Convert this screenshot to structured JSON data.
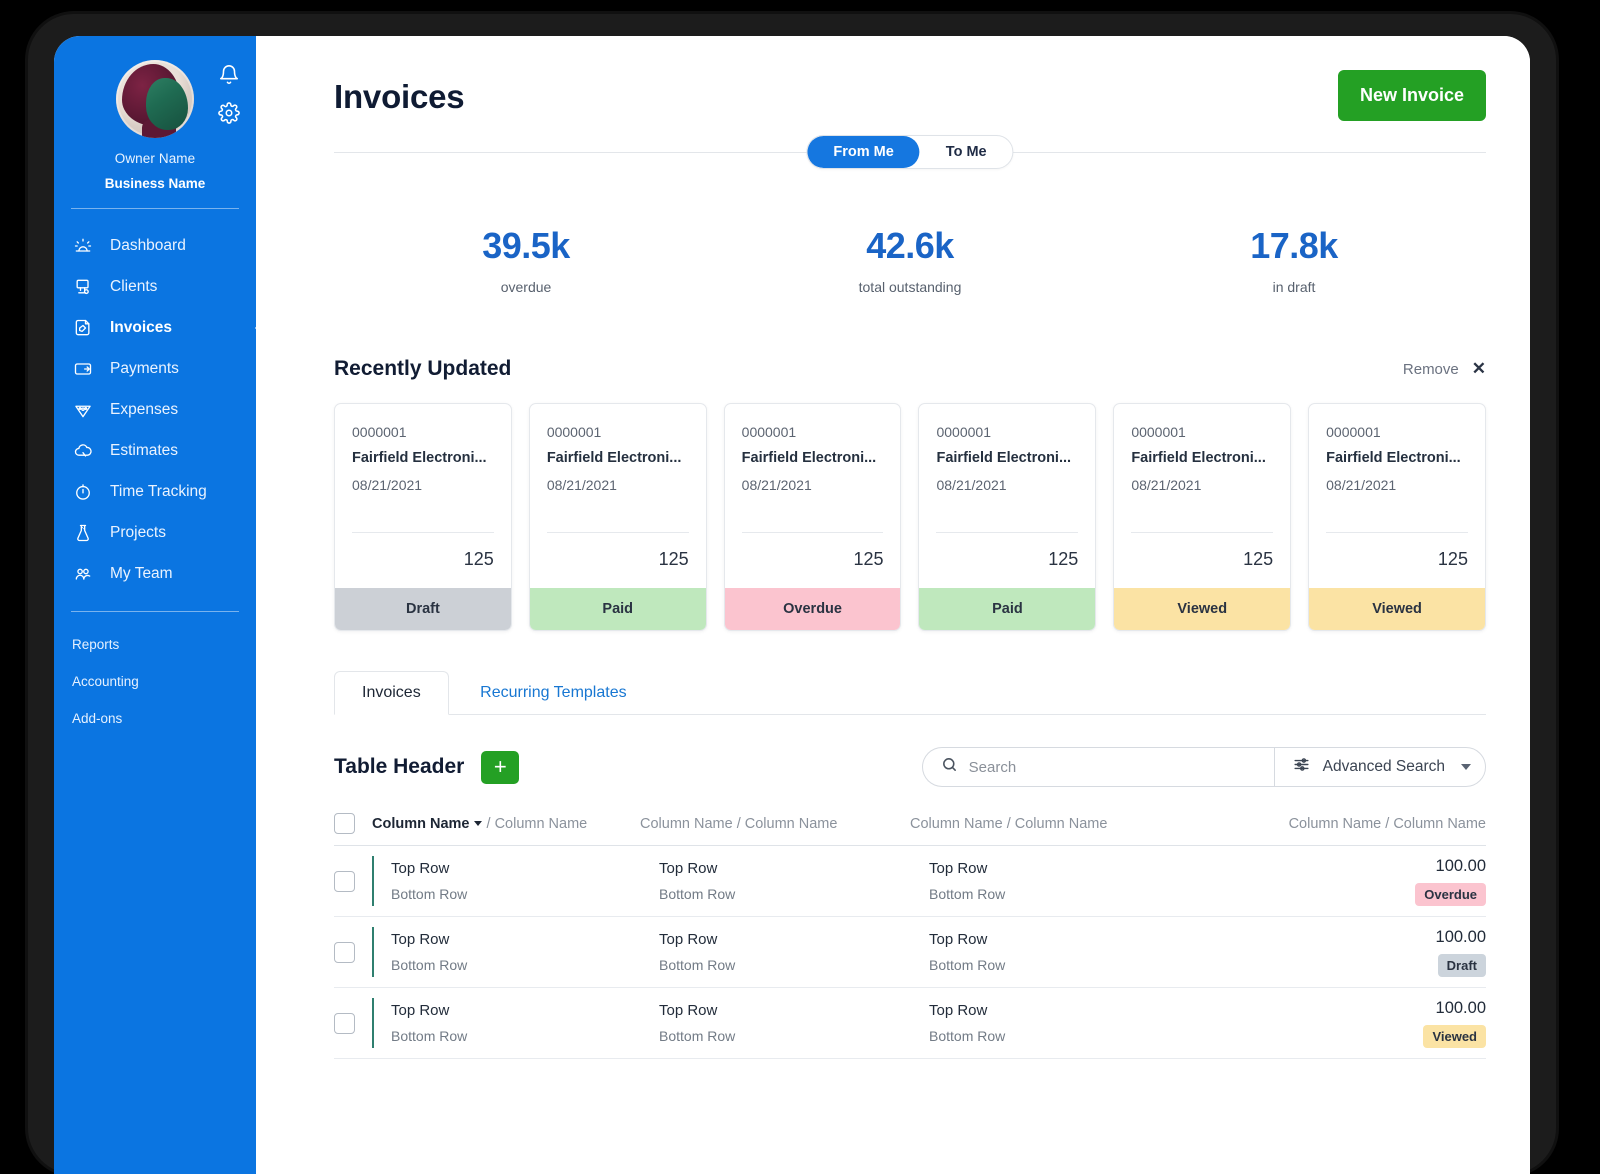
{
  "sidebar": {
    "owner_name": "Owner Name",
    "business_name": "Business Name",
    "bell_icon": "bell-icon",
    "gear_icon": "gear-icon",
    "items": [
      {
        "label": "Dashboard",
        "icon": "dashboard-icon",
        "active": false
      },
      {
        "label": "Clients",
        "icon": "clients-icon",
        "active": false
      },
      {
        "label": "Invoices",
        "icon": "invoices-icon",
        "active": true
      },
      {
        "label": "Payments",
        "icon": "payments-icon",
        "active": false
      },
      {
        "label": "Expenses",
        "icon": "expenses-icon",
        "active": false
      },
      {
        "label": "Estimates",
        "icon": "estimates-icon",
        "active": false
      },
      {
        "label": "Time Tracking",
        "icon": "time-tracking-icon",
        "active": false
      },
      {
        "label": "Projects",
        "icon": "projects-icon",
        "active": false
      },
      {
        "label": "My Team",
        "icon": "my-team-icon",
        "active": false
      }
    ],
    "sub_items": [
      {
        "label": "Reports"
      },
      {
        "label": "Accounting"
      },
      {
        "label": "Add-ons"
      }
    ]
  },
  "header": {
    "title": "Invoices",
    "new_invoice_label": "New Invoice",
    "segmented": {
      "options": [
        "From Me",
        "To Me"
      ],
      "selected": "From Me"
    }
  },
  "stats": [
    {
      "value": "39.5k",
      "label": "overdue"
    },
    {
      "value": "42.6k",
      "label": "total outstanding"
    },
    {
      "value": "17.8k",
      "label": "in draft"
    }
  ],
  "recently_updated": {
    "title": "Recently Updated",
    "remove_label": "Remove",
    "close_icon": "close-icon",
    "cards": [
      {
        "number": "0000001",
        "client": "Fairfield Electroni...",
        "date": "08/21/2021",
        "amount": "125",
        "status": "Draft",
        "status_key": "draft"
      },
      {
        "number": "0000001",
        "client": "Fairfield Electroni...",
        "date": "08/21/2021",
        "amount": "125",
        "status": "Paid",
        "status_key": "paid"
      },
      {
        "number": "0000001",
        "client": "Fairfield Electroni...",
        "date": "08/21/2021",
        "amount": "125",
        "status": "Overdue",
        "status_key": "overdue"
      },
      {
        "number": "0000001",
        "client": "Fairfield Electroni...",
        "date": "08/21/2021",
        "amount": "125",
        "status": "Paid",
        "status_key": "paid"
      },
      {
        "number": "0000001",
        "client": "Fairfield Electroni...",
        "date": "08/21/2021",
        "amount": "125",
        "status": "Viewed",
        "status_key": "viewed"
      },
      {
        "number": "0000001",
        "client": "Fairfield Electroni...",
        "date": "08/21/2021",
        "amount": "125",
        "status": "Viewed",
        "status_key": "viewed"
      }
    ]
  },
  "tabs": [
    {
      "label": "Invoices",
      "active": true
    },
    {
      "label": "Recurring Templates",
      "active": false
    }
  ],
  "table_section": {
    "title": "Table Header",
    "add_label": "+",
    "search": {
      "placeholder": "Search",
      "value": "",
      "icon": "search-icon"
    },
    "advanced_search": {
      "label": "Advanced Search",
      "icon": "filter-sliders-icon",
      "caret": "chevron-down-icon"
    },
    "columns": [
      {
        "primary": "Column Name",
        "secondary": "Column Name",
        "sortable": true
      },
      {
        "primary": "Column Name",
        "secondary": "Column Name",
        "sortable": false
      },
      {
        "primary": "Column Name",
        "secondary": "Column Name",
        "sortable": false
      },
      {
        "primary": "Column Name",
        "secondary": "Column Name",
        "sortable": false
      }
    ],
    "rows": [
      {
        "c1_top": "Top Row",
        "c1_bottom": "Bottom Row",
        "c2_top": "Top Row",
        "c2_bottom": "Bottom Row",
        "c3_top": "Top Row",
        "c3_bottom": "Bottom Row",
        "amount": "100.00",
        "status": "Overdue",
        "status_key": "overdue"
      },
      {
        "c1_top": "Top Row",
        "c1_bottom": "Bottom Row",
        "c2_top": "Top Row",
        "c2_bottom": "Bottom Row",
        "c3_top": "Top Row",
        "c3_bottom": "Bottom Row",
        "amount": "100.00",
        "status": "Draft",
        "status_key": "draft"
      },
      {
        "c1_top": "Top Row",
        "c1_bottom": "Bottom Row",
        "c2_top": "Top Row",
        "c2_bottom": "Bottom Row",
        "c3_top": "Top Row",
        "c3_bottom": "Bottom Row",
        "amount": "100.00",
        "status": "Viewed",
        "status_key": "viewed"
      }
    ]
  },
  "colors": {
    "sidebar_blue": "#0b75e1",
    "accent_green": "#24a024",
    "stat_blue": "#1a64c6",
    "segment_blue": "#1577e0",
    "row_accent": "#2f7f6f",
    "status_draft": "#ccd0d6",
    "status_paid": "#bfe8bd",
    "status_overdue": "#fbc4cf",
    "status_viewed": "#fbe3a4"
  }
}
